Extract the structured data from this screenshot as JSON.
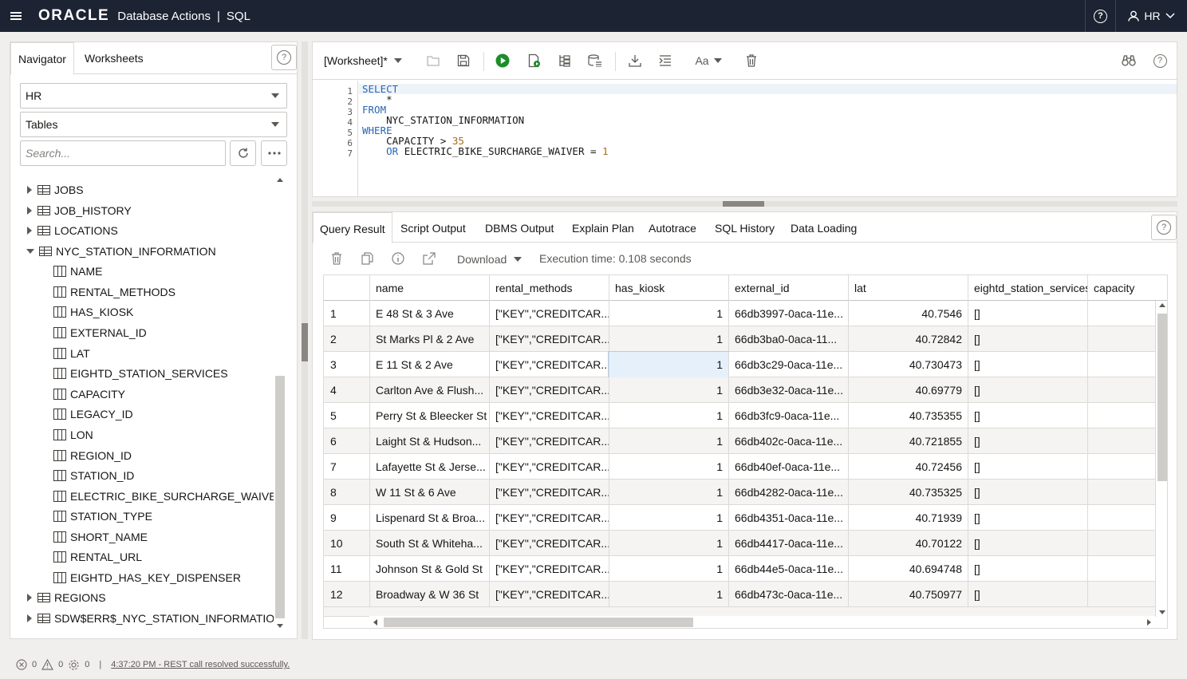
{
  "header": {
    "brand": "ORACLE",
    "app": "Database Actions",
    "sep": "|",
    "page": "SQL",
    "user": "HR",
    "help_glyph": "?"
  },
  "navigator": {
    "tabs": [
      "Navigator",
      "Worksheets"
    ],
    "help_glyph": "?",
    "schema": "HR",
    "object_type": "Tables",
    "search_placeholder": "Search...",
    "tree": [
      {
        "label": "JOBS",
        "type": "table",
        "state": "collapsed"
      },
      {
        "label": "JOB_HISTORY",
        "type": "table",
        "state": "collapsed"
      },
      {
        "label": "LOCATIONS",
        "type": "table",
        "state": "collapsed"
      },
      {
        "label": "NYC_STATION_INFORMATION",
        "type": "table",
        "state": "expanded"
      },
      {
        "label": "NAME",
        "type": "column"
      },
      {
        "label": "RENTAL_METHODS",
        "type": "column"
      },
      {
        "label": "HAS_KIOSK",
        "type": "column"
      },
      {
        "label": "EXTERNAL_ID",
        "type": "column"
      },
      {
        "label": "LAT",
        "type": "column"
      },
      {
        "label": "EIGHTD_STATION_SERVICES",
        "type": "column"
      },
      {
        "label": "CAPACITY",
        "type": "column"
      },
      {
        "label": "LEGACY_ID",
        "type": "column"
      },
      {
        "label": "LON",
        "type": "column"
      },
      {
        "label": "REGION_ID",
        "type": "column"
      },
      {
        "label": "STATION_ID",
        "type": "column"
      },
      {
        "label": "ELECTRIC_BIKE_SURCHARGE_WAIVER",
        "type": "column"
      },
      {
        "label": "STATION_TYPE",
        "type": "column"
      },
      {
        "label": "SHORT_NAME",
        "type": "column"
      },
      {
        "label": "RENTAL_URL",
        "type": "column"
      },
      {
        "label": "EIGHTD_HAS_KEY_DISPENSER",
        "type": "column"
      },
      {
        "label": "REGIONS",
        "type": "table",
        "state": "collapsed"
      },
      {
        "label": "SDW$ERR$_NYC_STATION_INFORMATION",
        "type": "table",
        "state": "collapsed"
      }
    ]
  },
  "worksheet": {
    "title": "[Worksheet]*",
    "help_glyph": "?",
    "line_numbers": [
      "1",
      "2",
      "3",
      "4",
      "5",
      "6",
      "7"
    ],
    "code_lines": [
      [
        {
          "t": "SELECT",
          "k": "kw"
        }
      ],
      [
        {
          "t": "    *",
          "k": ""
        }
      ],
      [
        {
          "t": "FROM",
          "k": "kw"
        }
      ],
      [
        {
          "t": "    NYC_STATION_INFORMATION",
          "k": ""
        }
      ],
      [
        {
          "t": "WHERE",
          "k": "kw"
        }
      ],
      [
        {
          "t": "    CAPACITY > ",
          "k": ""
        },
        {
          "t": "35",
          "k": "num"
        }
      ],
      [
        {
          "t": "    ",
          "k": ""
        },
        {
          "t": "OR",
          "k": "kw"
        },
        {
          "t": " ELECTRIC_BIKE_SURCHARGE_WAIVER = ",
          "k": ""
        },
        {
          "t": "1",
          "k": "num"
        }
      ]
    ]
  },
  "results": {
    "tabs": [
      "Query Result",
      "Script Output",
      "DBMS Output",
      "Explain Plan",
      "Autotrace",
      "SQL History",
      "Data Loading"
    ],
    "help_glyph": "?",
    "download_label": "Download",
    "execution_time": "Execution time: 0.108 seconds",
    "columns": [
      "name",
      "rental_methods",
      "has_kiosk",
      "external_id",
      "lat",
      "eightd_station_services",
      "capacity"
    ],
    "rows": [
      [
        "1",
        "E 48 St & 3 Ave",
        "[\"KEY\",\"CREDITCAR...",
        "1",
        "66db3997-0aca-11e...",
        "40.7546",
        "[]",
        ""
      ],
      [
        "2",
        "St Marks Pl & 2 Ave",
        "[\"KEY\",\"CREDITCAR...",
        "1",
        "66db3ba0-0aca-11...",
        "40.72842",
        "[]",
        ""
      ],
      [
        "3",
        "E 11 St & 2 Ave",
        "[\"KEY\",\"CREDITCAR...",
        "1",
        "66db3c29-0aca-11e...",
        "40.730473",
        "[]",
        ""
      ],
      [
        "4",
        "Carlton Ave & Flush...",
        "[\"KEY\",\"CREDITCAR...",
        "1",
        "66db3e32-0aca-11e...",
        "40.69779",
        "[]",
        ""
      ],
      [
        "5",
        "Perry St & Bleecker St",
        "[\"KEY\",\"CREDITCAR...",
        "1",
        "66db3fc9-0aca-11e...",
        "40.735355",
        "[]",
        ""
      ],
      [
        "6",
        "Laight St & Hudson...",
        "[\"KEY\",\"CREDITCAR...",
        "1",
        "66db402c-0aca-11e...",
        "40.721855",
        "[]",
        ""
      ],
      [
        "7",
        "Lafayette St & Jerse...",
        "[\"KEY\",\"CREDITCAR...",
        "1",
        "66db40ef-0aca-11e...",
        "40.72456",
        "[]",
        ""
      ],
      [
        "8",
        "W 11 St & 6 Ave",
        "[\"KEY\",\"CREDITCAR...",
        "1",
        "66db4282-0aca-11e...",
        "40.735325",
        "[]",
        ""
      ],
      [
        "9",
        "Lispenard St & Broa...",
        "[\"KEY\",\"CREDITCAR...",
        "1",
        "66db4351-0aca-11e...",
        "40.71939",
        "[]",
        ""
      ],
      [
        "10",
        "South St & Whiteha...",
        "[\"KEY\",\"CREDITCAR...",
        "1",
        "66db4417-0aca-11e...",
        "40.70122",
        "[]",
        ""
      ],
      [
        "11",
        "Johnson St & Gold St",
        "[\"KEY\",\"CREDITCAR...",
        "1",
        "66db44e5-0aca-11e...",
        "40.694748",
        "[]",
        ""
      ],
      [
        "12",
        "Broadway & W 36 St",
        "[\"KEY\",\"CREDITCAR...",
        "1",
        "66db473c-0aca-11e...",
        "40.750977",
        "[]",
        ""
      ]
    ]
  },
  "status": {
    "errors": "0",
    "warnings": "0",
    "tasks": "0",
    "sep": "|",
    "message": "4:37:20 PM - REST call resolved successfully."
  },
  "icons": [
    "hamburger-icon",
    "help-icon",
    "user-icon",
    "refresh-icon",
    "more-icon",
    "table-icon",
    "column-icon",
    "run-icon",
    "run-script-icon",
    "explain-icon",
    "autotrace-icon",
    "download-icon",
    "format-icon",
    "font-icon",
    "trash-icon",
    "binoculars-icon"
  ],
  "colors": {
    "header_bg": "#1c2433",
    "run_green": "#1b8e2a",
    "keyword_blue": "#2766b5",
    "number_orange": "#a86b1b"
  }
}
